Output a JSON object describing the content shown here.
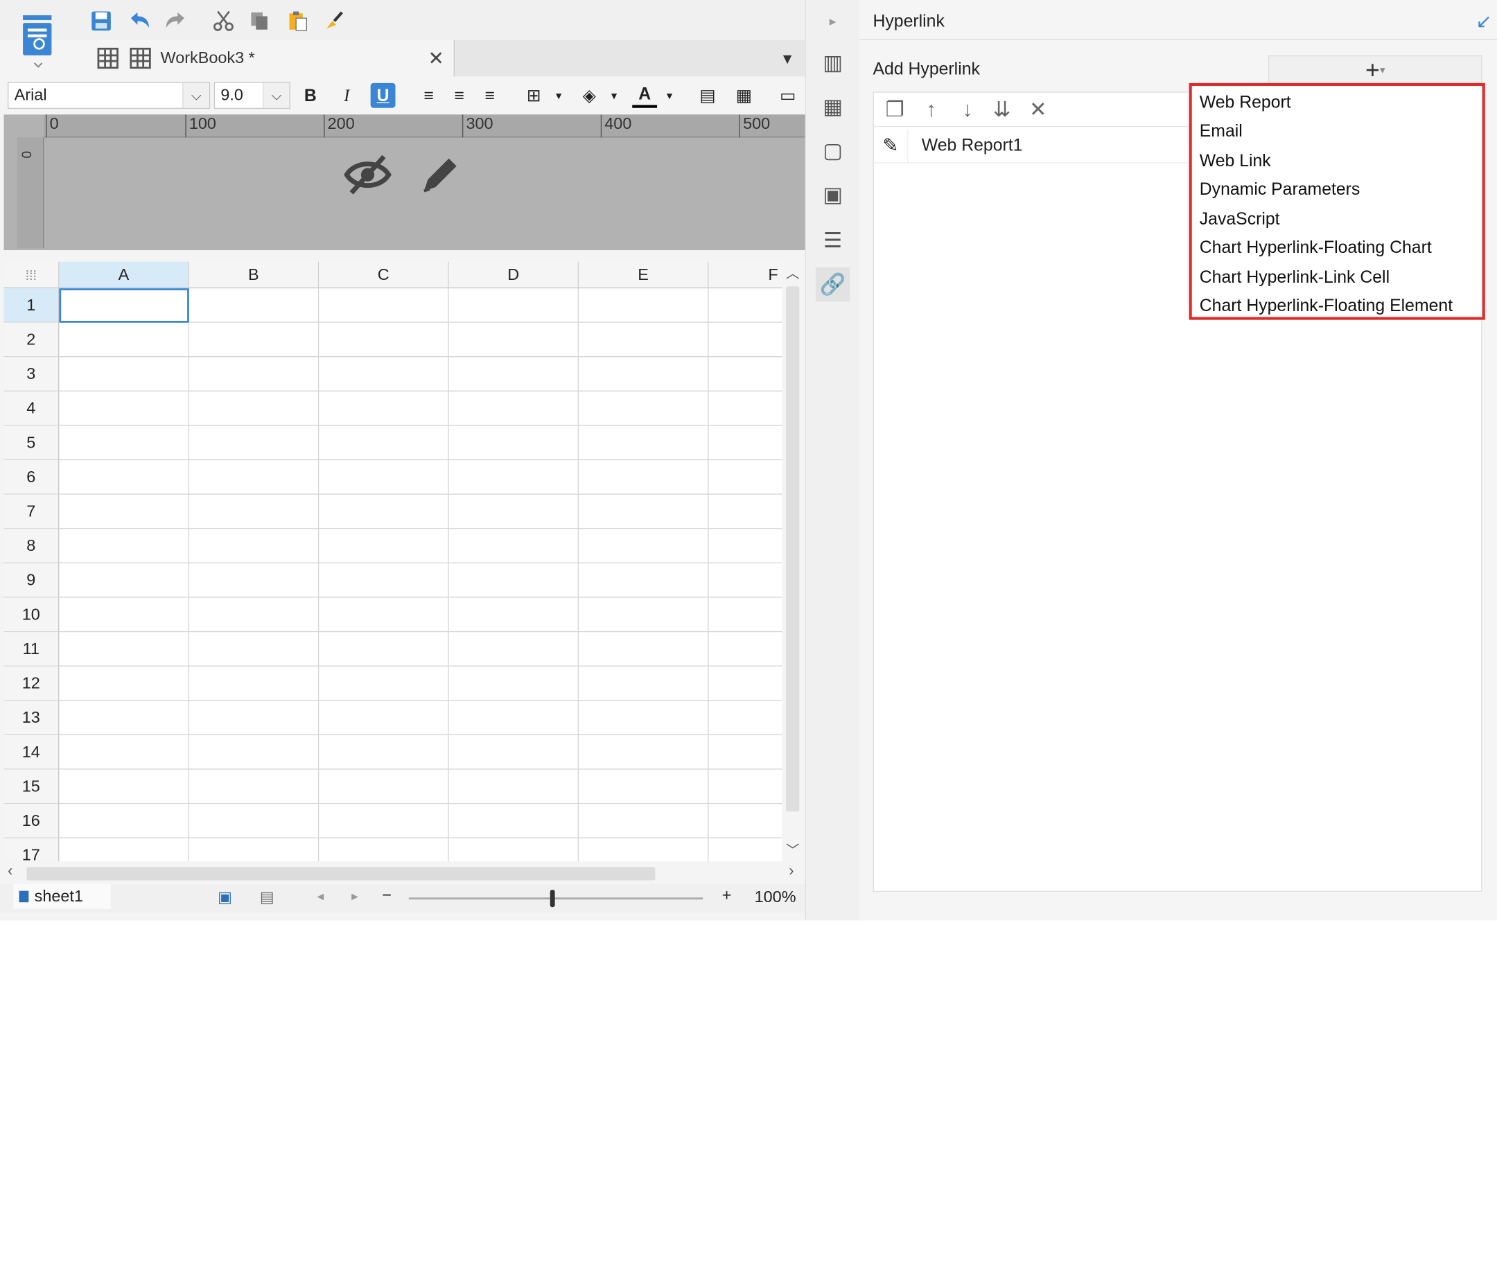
{
  "toolbar": {
    "icons": [
      "logo-icon",
      "save-icon",
      "undo-icon",
      "redo-icon",
      "cut-icon",
      "copy-icon",
      "paste-icon",
      "format-painter-icon"
    ]
  },
  "tab": {
    "title": "WorkBook3  *"
  },
  "format": {
    "font": "Arial",
    "size": "9.0",
    "bold": "B",
    "italic": "I",
    "underline": "U"
  },
  "ruler": {
    "ticks": [
      "0",
      "100",
      "200",
      "300",
      "400",
      "500"
    ],
    "vertical_zero": "0"
  },
  "sheet": {
    "columns": [
      "A",
      "B",
      "C",
      "D",
      "E",
      "F"
    ],
    "rows": [
      "1",
      "2",
      "3",
      "4",
      "5",
      "6",
      "7",
      "8",
      "9",
      "10",
      "11",
      "12",
      "13",
      "14",
      "15",
      "16",
      "17"
    ]
  },
  "status": {
    "sheet_name": "sheet1",
    "zoom": "100%",
    "minus": "−",
    "plus": "+"
  },
  "panel": {
    "title": "Hyperlink",
    "add_label": "Add Hyperlink",
    "add_button": "+",
    "items": [
      {
        "name": "Web Report1"
      }
    ]
  },
  "menu": {
    "items": [
      "Web Report",
      "Email",
      "Web Link",
      "Dynamic Parameters",
      "JavaScript",
      "Chart Hyperlink-Floating Chart",
      "Chart Hyperlink-Link Cell",
      "Chart Hyperlink-Floating Element"
    ],
    "highlight_color": "#e02b2b"
  },
  "colors": {
    "accent": "#3a86d4"
  }
}
